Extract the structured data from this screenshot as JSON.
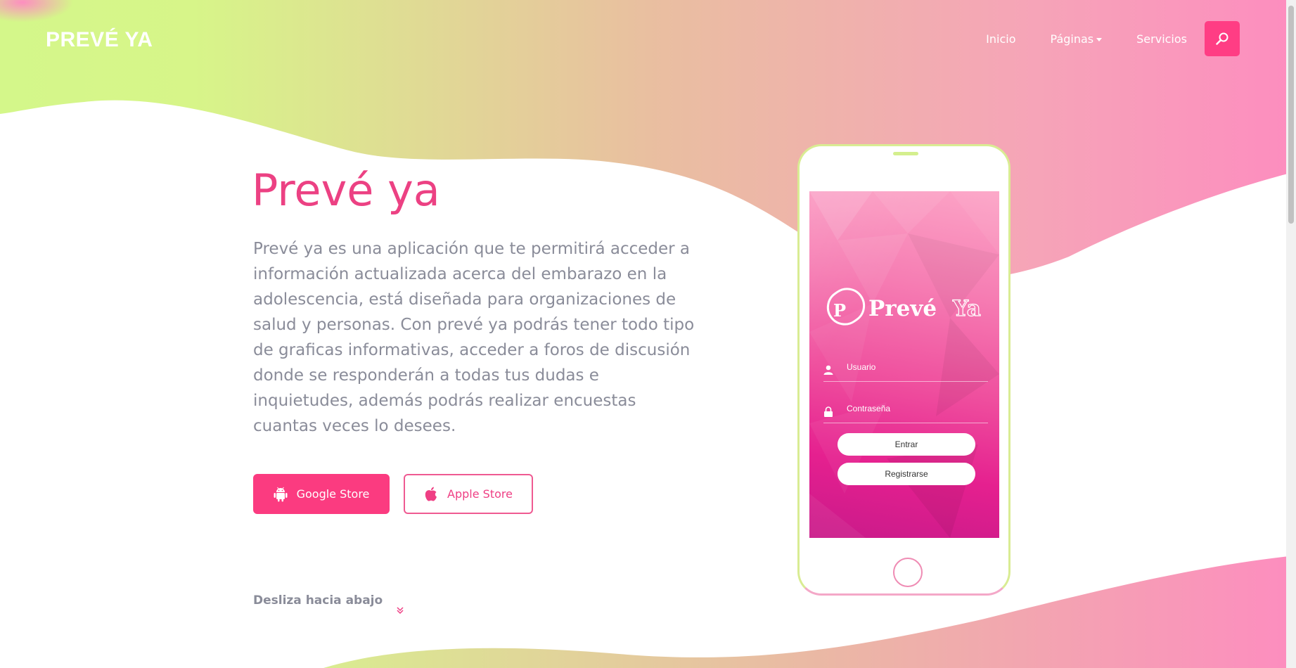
{
  "colors": {
    "accent": "#fb3b80",
    "title": "#ec4183",
    "body_text": "#8a8c99",
    "lime": "#d4f58c",
    "pink": "#fd8ec0",
    "tan": "#e9bea0"
  },
  "navbar": {
    "brand": "PREVÉ YA",
    "items": [
      {
        "label": "Inicio"
      },
      {
        "label": "Páginas",
        "has_dropdown": true
      },
      {
        "label": "Servicios"
      }
    ],
    "search_icon": "search-icon"
  },
  "hero": {
    "title": "Prevé ya",
    "description": "Prevé ya es una aplicación que te permitirá acceder a información actualizada acerca del embarazo en la adolescencia, está diseñada para organizaciones de salud y personas. Con prevé ya podrás tener todo tipo de graficas informativas, acceder a foros de discusión donde se responderán a todas tus dudas e inquietudes, además podrás realizar encuestas cuantas veces lo desees.",
    "buttons": [
      {
        "label": "Google Store",
        "icon": "android-icon"
      },
      {
        "label": "Apple Store",
        "icon": "apple-icon"
      }
    ],
    "scroll_hint": "Desliza hacia abajo"
  },
  "phone_app": {
    "logo_text": "Prevé",
    "logo_text_2": "Ya",
    "logo_badge": "P",
    "fields": [
      {
        "label": "Usuario",
        "icon": "user-icon"
      },
      {
        "label": "Contraseña",
        "icon": "lock-icon"
      }
    ],
    "login_button": "Entrar",
    "register_button": "Registrarse"
  }
}
